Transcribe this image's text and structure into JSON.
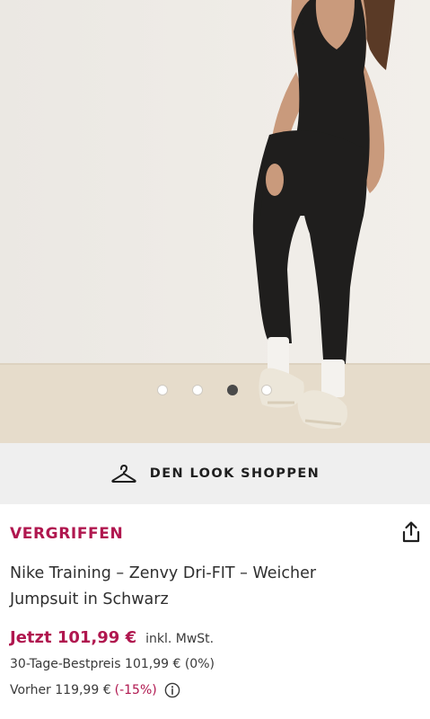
{
  "gallery": {
    "image_alt": "Model im schwarzen Jumpsuit, Rückansicht",
    "slide_count": 4,
    "active_index": 2
  },
  "look": {
    "label": "DEN LOOK SHOPPEN",
    "icon": "hanger-icon"
  },
  "product": {
    "status": "VERGRIFFEN",
    "title_line1": "Nike Training – Zenvy Dri-FIT – Weicher",
    "title_line2": "Jumpsuit in Schwarz",
    "price_now": "Jetzt 101,99 €",
    "tax_note": "inkl. MwSt.",
    "best_price": "30-Tage-Bestpreis 101,99 € (0%)",
    "before_price": "Vorher 119,99 €",
    "discount": "(-15%)"
  },
  "icons": {
    "share": "share-icon",
    "info": "info-icon"
  },
  "colors": {
    "accent": "#b0174f",
    "look_bar_bg": "#efefef",
    "dot_active": "#4a4a4a"
  }
}
